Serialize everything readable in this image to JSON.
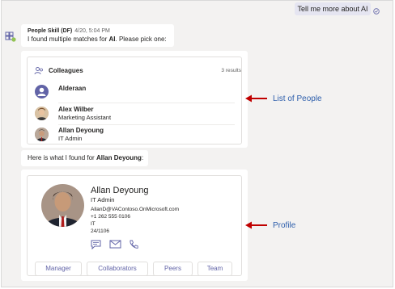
{
  "user_message": "Tell me more about AI",
  "bot_message_1": {
    "sender": "People Skill (DF)",
    "time": "4/20, 5:04 PM",
    "text_prefix": "I found multiple matches for ",
    "text_bold": "AI",
    "text_suffix": ". Please pick one:"
  },
  "people_list": {
    "header": "Colleagues",
    "count": "3 results",
    "people": [
      {
        "name": "Alderaan",
        "title": ""
      },
      {
        "name": "Alex Wilber",
        "title": "Marketing Assistant"
      },
      {
        "name": "Allan Deyoung",
        "title": "IT Admin"
      }
    ]
  },
  "bot_message_2": {
    "text_prefix": "Here is what I found for ",
    "text_bold": "Allan Deyoung",
    "text_suffix": ":"
  },
  "profile": {
    "name": "Allan Deyoung",
    "title": "IT Admin",
    "email": "AllanD@VAContoso.OnMicrosoft.com",
    "phone": "+1 262 555 0106",
    "department": "IT",
    "office": "24/1106",
    "buttons": [
      "Manager",
      "Collaborators",
      "Peers",
      "Team"
    ]
  },
  "annotations": {
    "list_label": "List of People",
    "profile_label": "Profile"
  },
  "colors": {
    "accent": "#6264a7",
    "annotation_arrow": "#c00000",
    "annotation_text": "#2e5fac",
    "user_bubble": "#e5e5f1"
  },
  "icons": [
    "check-circle-icon",
    "bot-app-icon",
    "people-icon",
    "chat-icon",
    "mail-icon",
    "phone-icon",
    "arrow-left-icon"
  ]
}
